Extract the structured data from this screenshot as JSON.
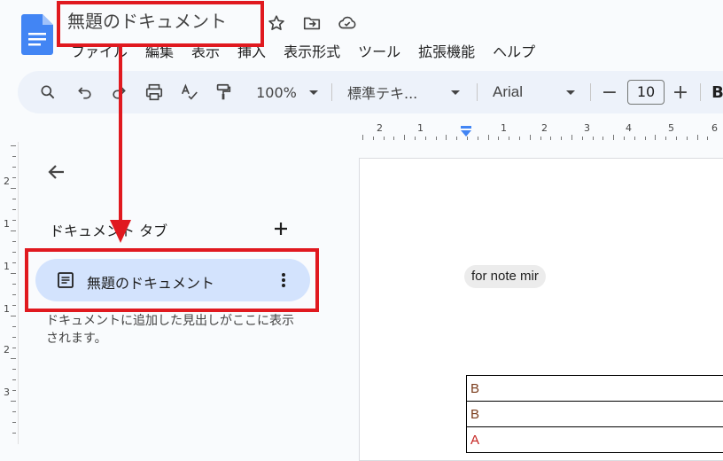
{
  "header": {
    "doc_title": "無題のドキュメント",
    "icons": [
      "docs-logo-icon",
      "star-icon",
      "move-to-folder-icon",
      "cloud-saved-icon"
    ]
  },
  "menubar": {
    "items": [
      "ファイル",
      "編集",
      "表示",
      "挿入",
      "表示形式",
      "ツール",
      "拡張機能",
      "ヘルプ"
    ]
  },
  "toolbar": {
    "zoom": "100%",
    "style": "標準テキ...",
    "font": "Arial",
    "font_size": "10",
    "minus": "−",
    "plus": "+",
    "bold": "B"
  },
  "ruler": {
    "labels": [
      "2",
      "1",
      "1",
      "2",
      "3",
      "4",
      "5",
      "6"
    ],
    "v_labels": [
      "2",
      "1",
      "1",
      "1",
      "2",
      "3"
    ]
  },
  "sidebar": {
    "tabs_heading": "ドキュメント タブ",
    "add_label": "+",
    "tab_label": "無題のドキュメント",
    "hint": "ドキュメントに追加した見出しがここに表示されます。"
  },
  "document": {
    "chip_text": "for note mir",
    "table_rows": [
      "B",
      "B",
      "A"
    ]
  },
  "colors": {
    "accent": "#0b57d0",
    "tab_selected": "#d3e3fd",
    "toolbar_bg": "#edf2fa",
    "annotation": "#e0191f",
    "table_text_brown": "#7a3b1a",
    "table_text_red": "#c5221f"
  }
}
